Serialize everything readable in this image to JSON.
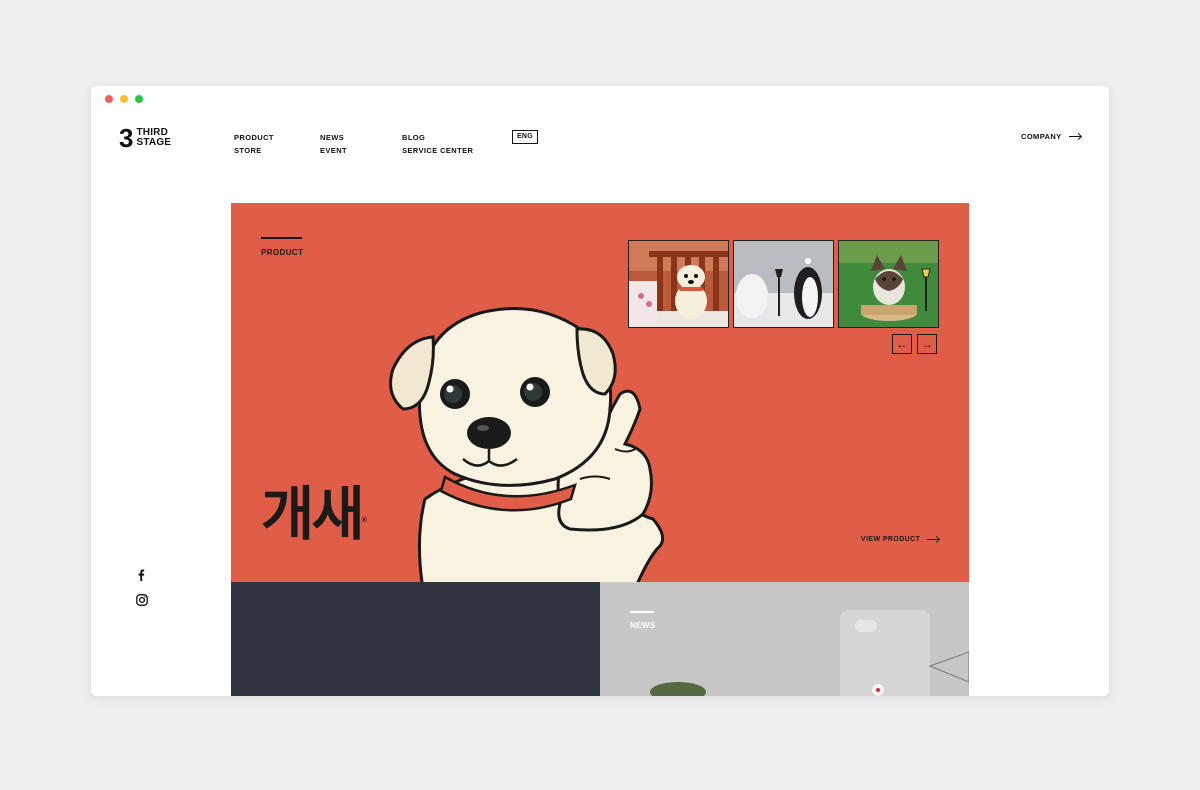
{
  "brand": {
    "logo_mark": "3",
    "logo_line1": "THIRD",
    "logo_line2": "STAGE"
  },
  "window_dots": [
    "#ef5f57",
    "#f6bd2f",
    "#29c841"
  ],
  "nav": {
    "col1": [
      "PRODUCT",
      "STORE"
    ],
    "col2": [
      "NEWS",
      "EVENT"
    ],
    "col3": [
      "BLOG",
      "SERVICE CENTER"
    ],
    "lang": "ENG",
    "company": "COMPANY"
  },
  "social": [
    "facebook-icon",
    "instagram-icon"
  ],
  "hero": {
    "label": "PRODUCT",
    "brand_title": "개새",
    "registered": "®",
    "view_product": "VIEW PRODUCT",
    "bg_color": "#e05e47",
    "thumbnails": [
      "dog-figure-on-bench",
      "penguin-figure-in-snow",
      "husky-figure-on-grass"
    ],
    "prev_arrow": "←",
    "next_arrow": "→"
  },
  "news": {
    "label": "NEWS"
  },
  "colors": {
    "dark_panel": "#2f3440",
    "news_panel": "#c7c7c8"
  }
}
